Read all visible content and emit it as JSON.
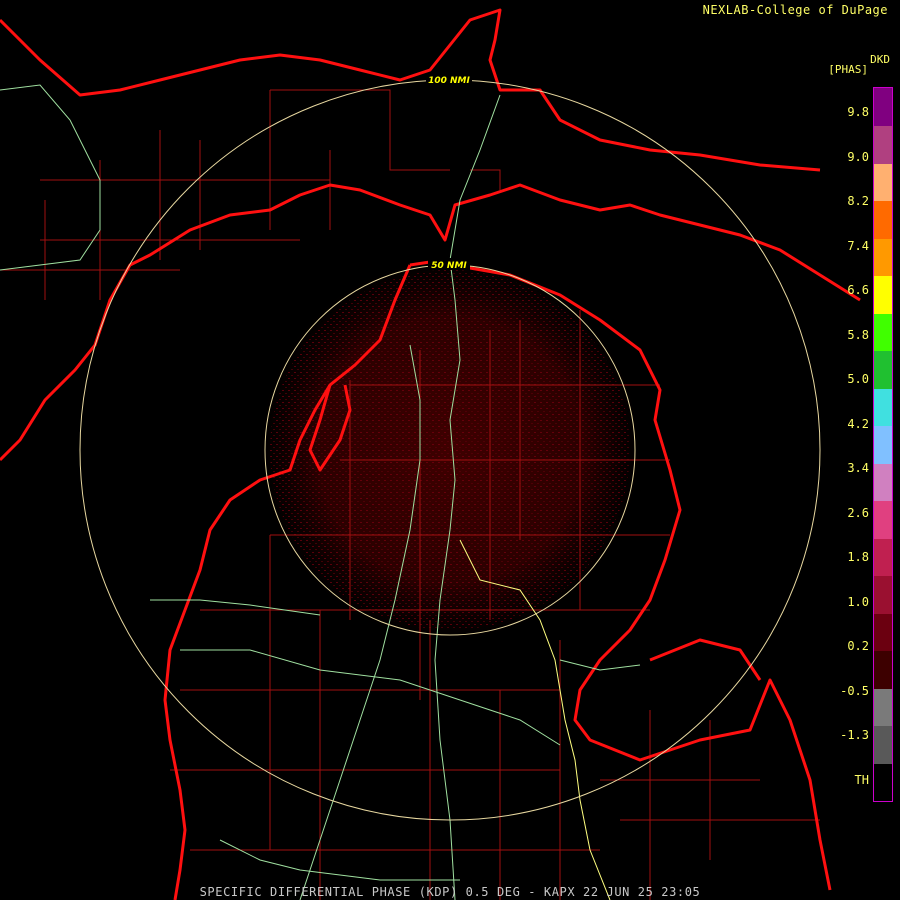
{
  "header": {
    "credit": "NEXLAB-College of DuPage",
    "product_code": "DKD",
    "units": "[PHAS]"
  },
  "range_rings": {
    "inner_label": "50 NMI",
    "outer_label": "100 NMI"
  },
  "legend": {
    "tick_labels": [
      "9.8",
      "9.0",
      "8.2",
      "7.4",
      "6.6",
      "5.8",
      "5.0",
      "4.2",
      "3.4",
      "2.6",
      "1.8",
      "1.0",
      "0.2",
      "-0.5",
      "-1.3",
      "TH"
    ],
    "colors": [
      "#000000",
      "#595959",
      "#7a7a7a",
      "#3d0000",
      "#6b0010",
      "#9a1030",
      "#c02050",
      "#e04080",
      "#d080c0",
      "#80c0ff",
      "#40e0e0",
      "#20c030",
      "#40ff00",
      "#ffff00",
      "#ff9900",
      "#ff6a00",
      "#ffb070",
      "#b04080",
      "#800080"
    ]
  },
  "footer": {
    "caption": "SPECIFIC DIFFERENTIAL PHASE (KDP) 0.5 DEG - KAPX 22 JUN 25 23:05"
  }
}
